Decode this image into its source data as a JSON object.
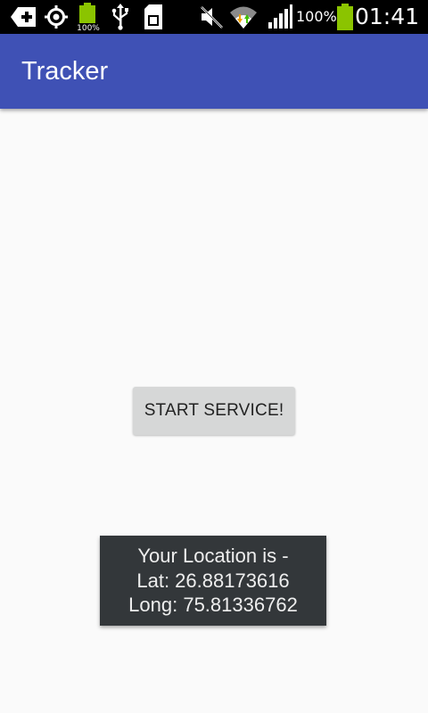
{
  "status_bar": {
    "battery_percent": "100%",
    "small_battery_label": "100%",
    "time": "01:41",
    "icons": [
      "add-box-icon",
      "gps-icon",
      "battery-charging-icon",
      "usb-icon",
      "sd-card-icon",
      "mute-icon",
      "wifi-icon",
      "signal-icon",
      "battery-icon"
    ]
  },
  "app_bar": {
    "title": "Tracker"
  },
  "main": {
    "start_button_label": "START SERVICE!"
  },
  "toast": {
    "line1": "Your Location is -",
    "line2": "Lat: 26.88173616",
    "line3": "Long: 75.81336762"
  },
  "colors": {
    "app_bar": "#3f51b5",
    "background": "#fafafa",
    "button": "#d6d7d7",
    "toast": "#33373a",
    "battery_green": "#8bc400"
  }
}
